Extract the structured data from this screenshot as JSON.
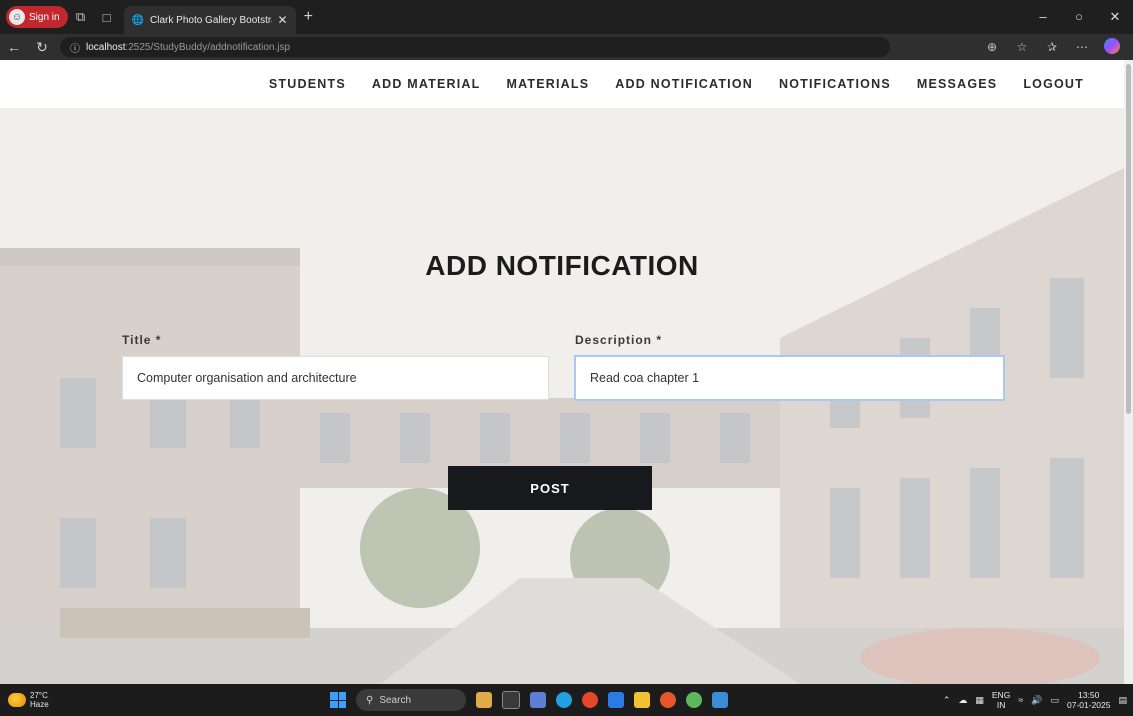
{
  "browser": {
    "signin_label": "Sign in",
    "tab_title": "Clark Photo Gallery Bootstrap Re",
    "url_host": "localhost",
    "url_path": ":2525/StudyBuddy/addnotification.jsp",
    "icons": {
      "profile": "person-icon",
      "workspaces": "workspaces-icon",
      "tab_actions": "tab-actions-icon",
      "tab_favicon": "globe-icon",
      "tab_close": "close-icon",
      "new_tab": "plus-icon",
      "back": "back-arrow-icon",
      "refresh": "refresh-icon",
      "site_info": "info-icon",
      "zoom": "zoom-icon",
      "favorite": "star-icon",
      "favorites": "favorites-icon",
      "more": "more-icon",
      "copilot": "copilot-icon"
    }
  },
  "nav": {
    "items": [
      {
        "label": "STUDENTS"
      },
      {
        "label": "ADD MATERIAL"
      },
      {
        "label": "MATERIALS"
      },
      {
        "label": "ADD NOTIFICATION"
      },
      {
        "label": "NOTIFICATIONS"
      },
      {
        "label": "MESSAGES"
      },
      {
        "label": "LOGOUT"
      }
    ]
  },
  "form": {
    "heading": "ADD NOTIFICATION",
    "title_label": "Title *",
    "title_value": "Computer organisation and architecture",
    "description_label": "Description *",
    "description_value": "Read coa chapter 1",
    "submit_label": "POST"
  },
  "taskbar": {
    "temperature": "27°C",
    "condition": "Haze",
    "search_label": "Search",
    "lang_top": "ENG",
    "lang_bottom": "IN",
    "time": "13:50",
    "date": "07-01-2025"
  },
  "colors": {
    "button_bg": "#17191c",
    "focus_border": "#a9c8f5",
    "signin_bg": "#c1272d"
  }
}
